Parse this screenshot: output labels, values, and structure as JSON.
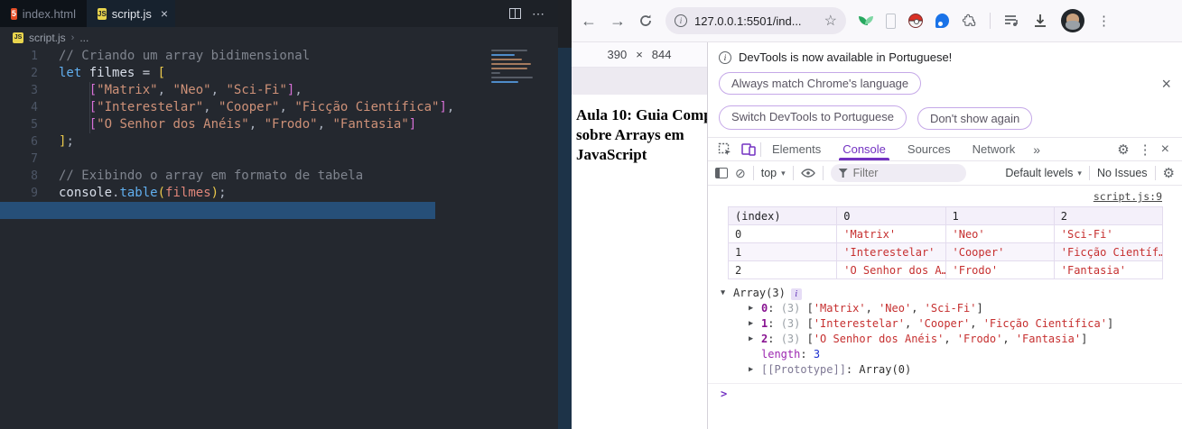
{
  "colors": {
    "accent": "#7332c2",
    "string": "#c62f2f",
    "keypurple": "#881391",
    "numblue": "#1c2fcf",
    "selection": "#264f78",
    "strip": "#1d3348",
    "editorbg": "#24282f"
  },
  "icons": {
    "close": "×",
    "ellipsis": "⋯",
    "chevron_right": "›",
    "back": "←",
    "forward": "→",
    "star": "☆",
    "dots_v": "⋮",
    "gear": "⚙",
    "block": "⊘",
    "dropdown": "▾",
    "more_tabs": "»",
    "prompt": ">",
    "html_badge": "5",
    "js_badge": "JS",
    "times_dim": "×"
  },
  "vscode": {
    "tabs": [
      {
        "label": "index.html"
      },
      {
        "label": "script.js"
      }
    ],
    "breadcrumb": {
      "file": "script.js",
      "more": "..."
    },
    "editor": {
      "lines": [
        {
          "num": "1",
          "tokens": [
            [
              "cm",
              "// Criando um array bidimensional"
            ]
          ]
        },
        {
          "num": "2",
          "tokens": [
            [
              "kw",
              "let"
            ],
            [
              "pl",
              " "
            ],
            [
              "vr",
              "filmes"
            ],
            [
              "op",
              " = "
            ],
            [
              "b1",
              "["
            ]
          ]
        },
        {
          "num": "3",
          "tokens": [
            [
              "pl",
              "    "
            ],
            [
              "b2",
              "["
            ],
            [
              "st",
              "\"Matrix\""
            ],
            [
              "pl",
              ", "
            ],
            [
              "st",
              "\"Neo\""
            ],
            [
              "pl",
              ", "
            ],
            [
              "st",
              "\"Sci-Fi\""
            ],
            [
              "b2",
              "]"
            ],
            [
              "pl",
              ","
            ]
          ]
        },
        {
          "num": "4",
          "tokens": [
            [
              "pl",
              "    "
            ],
            [
              "b2",
              "["
            ],
            [
              "st",
              "\"Interestelar\""
            ],
            [
              "pl",
              ", "
            ],
            [
              "st",
              "\"Cooper\""
            ],
            [
              "pl",
              ", "
            ],
            [
              "st",
              "\"Ficção Científica\""
            ],
            [
              "b2",
              "]"
            ],
            [
              "pl",
              ","
            ]
          ]
        },
        {
          "num": "5",
          "tokens": [
            [
              "pl",
              "    "
            ],
            [
              "b2",
              "["
            ],
            [
              "st",
              "\"O Senhor dos Anéis\""
            ],
            [
              "pl",
              ", "
            ],
            [
              "st",
              "\"Frodo\""
            ],
            [
              "pl",
              ", "
            ],
            [
              "st",
              "\"Fantasia\""
            ],
            [
              "b2",
              "]"
            ]
          ]
        },
        {
          "num": "6",
          "tokens": [
            [
              "b1",
              "]"
            ],
            [
              "pl",
              ";"
            ]
          ]
        },
        {
          "num": "7",
          "tokens": []
        },
        {
          "num": "8",
          "tokens": [
            [
              "cm",
              "// Exibindo o array em formato de tabela"
            ]
          ]
        },
        {
          "num": "9",
          "tokens": [
            [
              "vr",
              "console"
            ],
            [
              "pl",
              "."
            ],
            [
              "fn",
              "table"
            ],
            [
              "b1",
              "("
            ],
            [
              "pr",
              "filmes"
            ],
            [
              "b1",
              ")"
            ],
            [
              "pl",
              ";"
            ]
          ]
        },
        {
          "num": "10",
          "tokens": [],
          "selected": true
        }
      ]
    }
  },
  "browser": {
    "toolbar": {
      "url": "127.0.0.1:5501/ind..."
    },
    "device_toolbar": {
      "width": "390",
      "height": "844"
    },
    "page": {
      "heading_lines": [
        "Aula 10: Guia Comp",
        "sobre Arrays em",
        "JavaScript"
      ]
    }
  },
  "devtools": {
    "banner": {
      "title": "DevTools is now available in Portuguese!",
      "buttons": [
        "Always match Chrome's language",
        "Switch DevTools to Portuguese",
        "Don't show again"
      ]
    },
    "tabs": {
      "items": [
        "Elements",
        "Console",
        "Sources",
        "Network"
      ]
    },
    "console_toolbar": {
      "context": "top",
      "filter_placeholder": "Filter",
      "levels": "Default levels",
      "issues": "No Issues"
    },
    "console": {
      "source_link": "script.js:9",
      "table": {
        "headers": [
          "(index)",
          "0",
          "1",
          "2"
        ],
        "rows": [
          [
            "0",
            "'Matrix'",
            "'Neo'",
            "'Sci-Fi'"
          ],
          [
            "1",
            "'Interestelar'",
            "'Cooper'",
            "'Ficção Científ…"
          ],
          [
            "2",
            "'O Senhor dos A…",
            "'Frodo'",
            "'Fantasia'"
          ]
        ]
      },
      "tree_rows": [
        {
          "indent": 0,
          "caret": "▼",
          "badge": "i",
          "tokens": [
            [
              "p",
              "Array(3)"
            ]
          ]
        },
        {
          "indent": 1,
          "caret": "▶",
          "tokens": [
            [
              "key",
              "0"
            ],
            [
              "p",
              ": "
            ],
            [
              "gr",
              "(3) "
            ],
            [
              "p",
              "["
            ],
            [
              "s",
              "'Matrix'"
            ],
            [
              "p",
              ", "
            ],
            [
              "s",
              "'Neo'"
            ],
            [
              "p",
              ", "
            ],
            [
              "s",
              "'Sci-Fi'"
            ],
            [
              "p",
              "]"
            ]
          ]
        },
        {
          "indent": 1,
          "caret": "▶",
          "tokens": [
            [
              "key",
              "1"
            ],
            [
              "p",
              ": "
            ],
            [
              "gr",
              "(3) "
            ],
            [
              "p",
              "["
            ],
            [
              "s",
              "'Interestelar'"
            ],
            [
              "p",
              ", "
            ],
            [
              "s",
              "'Cooper'"
            ],
            [
              "p",
              ", "
            ],
            [
              "s",
              "'Ficção Científica'"
            ],
            [
              "p",
              "]"
            ]
          ]
        },
        {
          "indent": 1,
          "caret": "▶",
          "tokens": [
            [
              "key",
              "2"
            ],
            [
              "p",
              ": "
            ],
            [
              "gr",
              "(3) "
            ],
            [
              "p",
              "["
            ],
            [
              "s",
              "'O Senhor dos Anéis'"
            ],
            [
              "p",
              ", "
            ],
            [
              "s",
              "'Frodo'"
            ],
            [
              "p",
              ", "
            ],
            [
              "s",
              "'Fantasia'"
            ],
            [
              "p",
              "]"
            ]
          ]
        },
        {
          "indent": 1,
          "caret": "",
          "tokens": [
            [
              "key2",
              "length"
            ],
            [
              "p",
              ": "
            ],
            [
              "num",
              "3"
            ]
          ]
        },
        {
          "indent": 1,
          "caret": "▶",
          "tokens": [
            [
              "gr2",
              "[[Prototype]]"
            ],
            [
              "p",
              ": "
            ],
            [
              "p",
              "Array(0)"
            ]
          ]
        }
      ]
    }
  }
}
